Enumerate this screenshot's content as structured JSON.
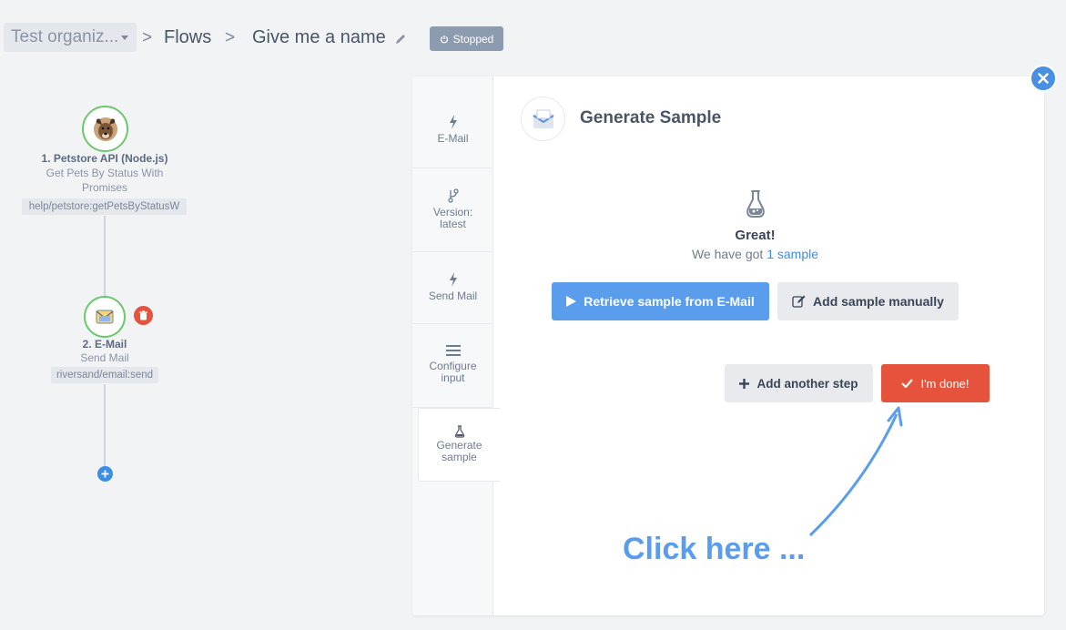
{
  "header": {
    "org": "Test organiz...",
    "crumbs": [
      "Flows",
      "Give me a name"
    ],
    "separator": ">",
    "status": "Stopped"
  },
  "flow": {
    "nodes": [
      {
        "title": "1. Petstore API (Node.js)",
        "subtitle": "Get Pets By Status With Promises",
        "chip": "help/petstore:getPetsByStatusW",
        "icon": "dog-avatar-icon"
      },
      {
        "title": "2. E-Mail",
        "subtitle": "Send Mail",
        "chip": "riversand/email:send",
        "icon": "email-icon"
      }
    ]
  },
  "panel": {
    "tabs": [
      {
        "label": "E-Mail",
        "icon": "lightning-icon"
      },
      {
        "label": "Version: latest",
        "icon": "branch-icon"
      },
      {
        "label": "Send Mail",
        "icon": "lightning-icon"
      },
      {
        "label": "Configure input",
        "icon": "menu-icon"
      },
      {
        "label": "Generate sample",
        "icon": "flask-icon"
      }
    ],
    "title": "Generate Sample",
    "great": "Great!",
    "got_prefix": "We have got ",
    "got_link": "1 sample",
    "retrieve": "Retrieve sample from E-Mail",
    "manual": "Add sample manually",
    "another": "Add another step",
    "done": "I'm done!"
  },
  "annotation": "Click here ...",
  "colors": {
    "accent": "#5a9ded",
    "danger": "#e5533d",
    "success": "#6cc86c"
  }
}
